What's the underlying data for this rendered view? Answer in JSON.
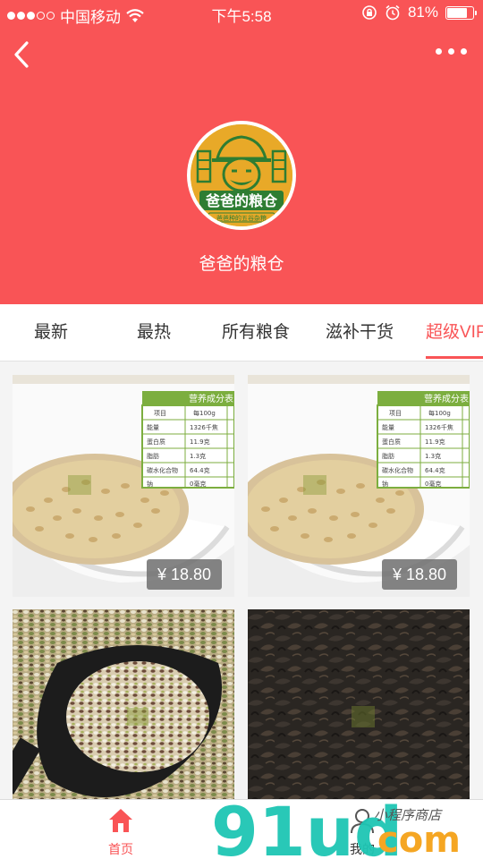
{
  "status_bar": {
    "carrier": "中国移动",
    "time": "下午5:58",
    "battery": "81%",
    "battery_level": 0.81
  },
  "header": {
    "shop_name": "爸爸的粮仓",
    "logo_text": "爸爸的粮仓",
    "logo_subtext": "爸爸种的五谷杂粮"
  },
  "tabs": [
    {
      "label": "最新"
    },
    {
      "label": "最热"
    },
    {
      "label": "所有粮食"
    },
    {
      "label": "滋补干货"
    },
    {
      "label": "超级VIP"
    }
  ],
  "products": [
    {
      "price": "¥ 18.80",
      "image": "wheat-grain-photo",
      "table_title": "营养成分表"
    },
    {
      "price": "¥ 18.80",
      "image": "wheat-grain-photo",
      "table_title": "营养成分表"
    },
    {
      "image": "mixed-grain-scoop-photo"
    },
    {
      "image": "dried-vegetable-photo"
    }
  ],
  "nutrition_table": {
    "header": [
      "项目",
      "每100g"
    ],
    "rows": [
      [
        "能量",
        "1326千焦"
      ],
      [
        "蛋白质",
        "11.9克"
      ],
      [
        "脂肪",
        "1.3克"
      ],
      [
        "碳水化合物",
        "64.4克"
      ],
      [
        "钠",
        "0毫克"
      ]
    ]
  },
  "tabbar": {
    "home_label": "首页",
    "mine_label": "我的"
  },
  "watermark": {
    "brand": "91ud",
    "suffix": "com",
    "tagline": "小程序商店"
  },
  "colors": {
    "brand": "#f95456",
    "logo_gold": "#e8a928",
    "logo_green": "#2e7d32"
  }
}
